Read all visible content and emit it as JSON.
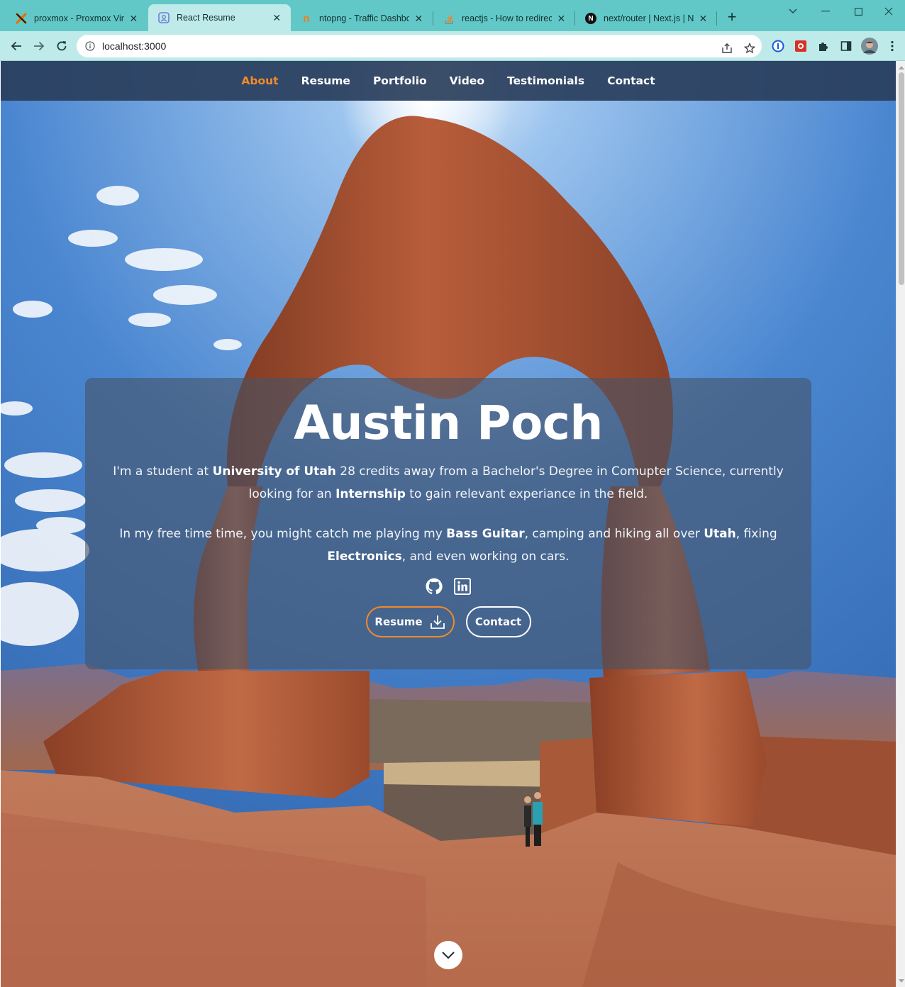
{
  "browser": {
    "tabs": [
      {
        "title": "proxmox - Proxmox Virtual Environment",
        "favicon": "proxmox-icon",
        "active": false
      },
      {
        "title": "React Resume",
        "favicon": "react-resume-icon",
        "active": true
      },
      {
        "title": "ntopng - Traffic Dashboard",
        "favicon": "ntopng-icon",
        "active": false
      },
      {
        "title": "reactjs - How to redirect",
        "favicon": "stackoverflow-icon",
        "active": false
      },
      {
        "title": "next/router | Next.js | Next.js",
        "favicon": "nextjs-icon",
        "active": false
      }
    ],
    "url": "localhost:3000",
    "colors": {
      "tabstrip": "#62c8c7",
      "toolbar": "#bfeaea"
    }
  },
  "site": {
    "nav": [
      {
        "label": "About",
        "active": true
      },
      {
        "label": "Resume",
        "active": false
      },
      {
        "label": "Portfolio",
        "active": false
      },
      {
        "label": "Video",
        "active": false
      },
      {
        "label": "Testimonials",
        "active": false
      },
      {
        "label": "Contact",
        "active": false
      }
    ],
    "hero": {
      "name": "Austin Poch",
      "p1": {
        "a": "I'm a student at ",
        "b": "University of Utah",
        "c": " 28 credits away from a Bachelor's Degree in Comupter Science, currently looking for an ",
        "d": "Internship",
        "e": " to gain relevant experiance in the field."
      },
      "p2": {
        "a": "In my free time time, you might catch me playing my ",
        "b": "Bass Guitar",
        "c": ", camping and hiking all over ",
        "d": "Utah",
        "e": ", fixing ",
        "f": "Electronics",
        "g": ", and even working on cars."
      },
      "socials": [
        "github-icon",
        "linkedin-icon"
      ],
      "buttons": {
        "resume": "Resume",
        "contact": "Contact"
      }
    },
    "colors": {
      "accent": "#f38a2a",
      "nav_bg": "#293e5c"
    }
  }
}
